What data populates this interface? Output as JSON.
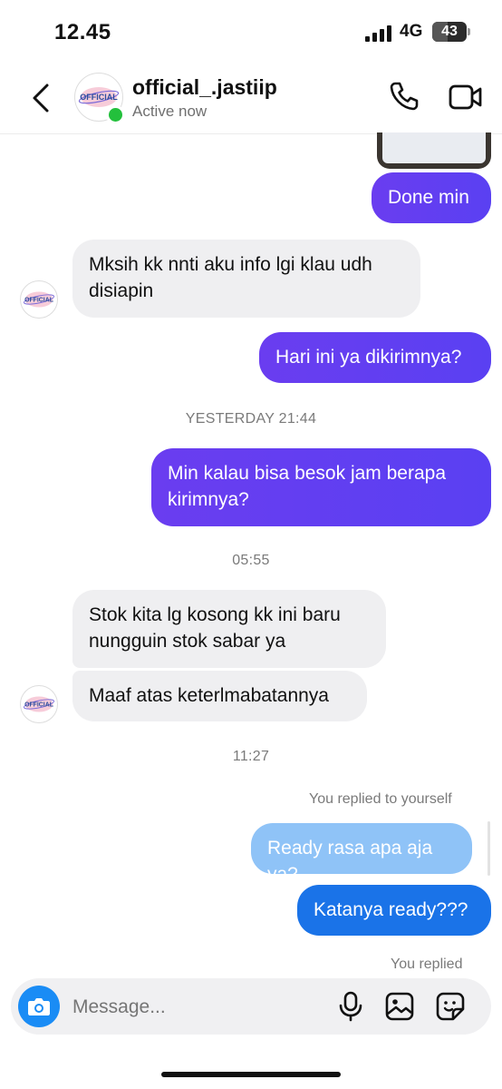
{
  "status_bar": {
    "time": "12.45",
    "network": "4G",
    "battery": "43"
  },
  "header": {
    "username": "official_.jastiip",
    "status": "Active now",
    "avatar_text": "OFFICIAL"
  },
  "messages": {
    "m1": "Done min",
    "m2": "Mksih kk nnti aku info lgi klau udh disiapin",
    "m3": "Hari ini ya dikirimnya?",
    "ts1": "YESTERDAY 21:44",
    "m4": "Min kalau bisa besok jam berapa kirimnya?",
    "ts2": "05:55",
    "m5": "Stok kita lg kosong kk ini baru nungguin stok sabar ya",
    "m6": "Maaf atas keterlmabatannya",
    "ts3": "11:27",
    "reply_note_1": "You replied to yourself",
    "m7": "Ready rasa apa aja ya?",
    "m8": "Katanya ready???",
    "reply_note_2": "You replied"
  },
  "composer": {
    "placeholder": "Message..."
  }
}
